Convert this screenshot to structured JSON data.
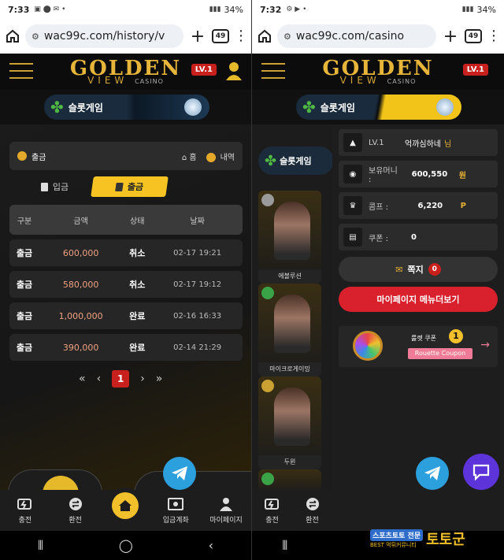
{
  "left": {
    "status": {
      "time": "7:33",
      "battery": "34%"
    },
    "browser": {
      "url": "wac99c.com/history/v",
      "tab_count": "49"
    },
    "logo": {
      "line1": "GOLDEN",
      "line2": "VIEW",
      "line3": "CASINO"
    },
    "level_badge": "LV.1",
    "category": {
      "label": "슬롯게임"
    },
    "withdraw_header": {
      "title": "출금",
      "home": "홈",
      "history": "내역"
    },
    "tabs": [
      {
        "label": "입금"
      },
      {
        "label": "출금"
      }
    ],
    "table": {
      "headers": [
        "구분",
        "금액",
        "상태",
        "날짜"
      ],
      "rows": [
        {
          "type": "출금",
          "amount": "600,000",
          "status": "취소",
          "date": "02-17 19:21"
        },
        {
          "type": "출금",
          "amount": "580,000",
          "status": "취소",
          "date": "02-17 19:12"
        },
        {
          "type": "출금",
          "amount": "1,000,000",
          "status": "완료",
          "date": "02-16 16:33"
        },
        {
          "type": "출금",
          "amount": "390,000",
          "status": "완료",
          "date": "02-14 21:29"
        }
      ]
    },
    "pager": {
      "first": "«",
      "prev": "‹",
      "page": "1",
      "next": "›",
      "last": "»"
    },
    "nav": [
      {
        "label": "충전",
        "icon": "charge-icon"
      },
      {
        "label": "환전",
        "icon": "exchange-icon"
      },
      {
        "label": "",
        "icon": "home-icon"
      },
      {
        "label": "입금계좌",
        "icon": "account-icon"
      },
      {
        "label": "마이페이지",
        "icon": "mypage-icon"
      }
    ]
  },
  "right": {
    "status": {
      "time": "7:32",
      "battery": "34%"
    },
    "browser": {
      "url": "wac99c.com/casino",
      "tab_count": "49"
    },
    "logo": {
      "line1": "GOLDEN",
      "line2": "VIEW",
      "line3": "CASINO"
    },
    "level_badge": "LV.1",
    "category": {
      "label": "슬롯게임"
    },
    "slot_button": "슬롯게임",
    "games": [
      {
        "caption": "에볼루션"
      },
      {
        "caption": "마이크로게이밍"
      },
      {
        "caption": "두윈"
      }
    ],
    "drawer": {
      "level": {
        "label": "LV.1",
        "name": "억까심하네",
        "suffix": "님"
      },
      "money": {
        "label": "보유머니 :",
        "value": "600,550",
        "unit": "원"
      },
      "comp": {
        "label": "콤프 :",
        "value": "6,220",
        "unit": "P"
      },
      "coupon": {
        "label": "쿠폰 :",
        "value": "0"
      },
      "message": {
        "label": "쪽지",
        "count": "0"
      },
      "mypage_menu": "마이페이지 메뉴더보기",
      "roulette": {
        "title": "룰렛 쿠폰",
        "count": "1",
        "button": "Rouette Coupon"
      }
    },
    "nav": [
      {
        "label": "충전",
        "icon": "charge-icon"
      },
      {
        "label": "환전",
        "icon": "exchange-icon"
      }
    ],
    "watermark": {
      "badge": "스포츠토토 전문",
      "sub": "BEST 먹튀커뮤니티",
      "brand": "토토군"
    }
  },
  "colors": {
    "gold": "#f2c419",
    "red": "#c8201d",
    "telegram": "#2ca0dc",
    "chat": "#5c34d9"
  }
}
